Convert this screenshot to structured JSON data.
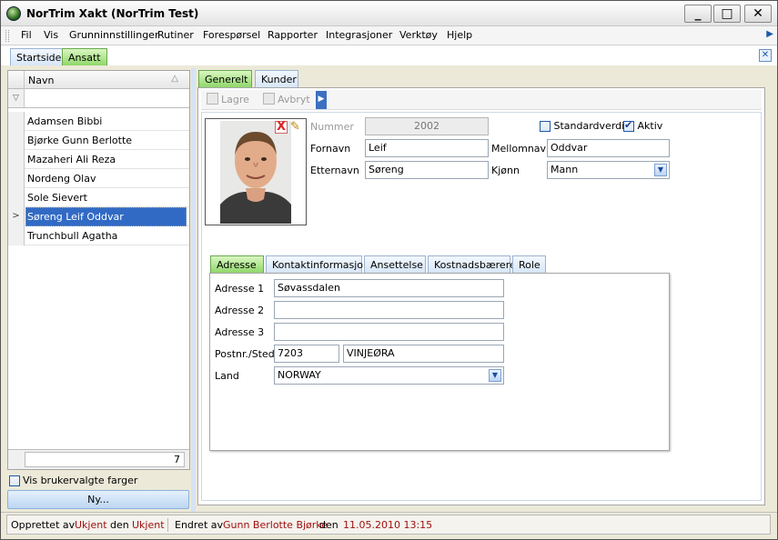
{
  "window": {
    "title": "NorTrim Xakt (NorTrim Test)",
    "minimize": "_",
    "maximize": "□",
    "close": "✕"
  },
  "menubar": {
    "items": [
      "Fil",
      "Vis",
      "Grunninnstillinger",
      "Rutiner",
      "Forespørsel",
      "Rapporter",
      "Integrasjoner",
      "Verktøy",
      "Hjelp"
    ],
    "overflow_arrow": "▶"
  },
  "doc_tabs": {
    "items": [
      {
        "label": "Startside",
        "active": false
      },
      {
        "label": "Ansatt",
        "active": true
      }
    ],
    "close": "✕"
  },
  "employee_list": {
    "column_header": "Navn",
    "sort_indicator": "△",
    "filter_icon": "▽",
    "rows": [
      "Adamsen Bibbi",
      "Bjørke Gunn Berlotte",
      "Mazaheri Ali Reza",
      "Nordeng Olav",
      "Sole Sievert",
      "Søreng Leif Oddvar",
      "Trunchbull Agatha"
    ],
    "selected_index": 5,
    "row_indicator": ">",
    "count": "7",
    "custom_colors_label": "Vis brukervalgte farger",
    "custom_colors_checked": false,
    "new_button": "Ny..."
  },
  "detail_tabs": {
    "items": [
      {
        "label": "Generelt",
        "active": true
      },
      {
        "label": "Kunder",
        "active": false
      }
    ]
  },
  "toolbar": {
    "save_label": "Lagre",
    "cancel_label": "Avbryt",
    "overflow": "▶"
  },
  "form": {
    "photo_delete": "X",
    "photo_edit": "✎",
    "nummer_label": "Nummer",
    "nummer_value": "2002",
    "standardverdi_label": "Standardverdi",
    "standardverdi_checked": false,
    "aktiv_label": "Aktiv",
    "aktiv_checked": true,
    "fornavn_label": "Fornavn",
    "fornavn_value": "Leif",
    "mellomnavn_label": "Mellomnavn",
    "mellomnavn_value": "Oddvar",
    "etternavn_label": "Etternavn",
    "etternavn_value": "Søreng",
    "kjonn_label": "Kjønn",
    "kjonn_value": "Mann",
    "dropdown_arrow": "▼"
  },
  "sub_tabs": {
    "items": [
      {
        "label": "Adresse",
        "active": true
      },
      {
        "label": "Kontaktinformasjon",
        "active": false
      },
      {
        "label": "Ansettelse",
        "active": false
      },
      {
        "label": "Kostnadsbærere",
        "active": false
      },
      {
        "label": "Role",
        "active": false
      }
    ]
  },
  "address": {
    "adresse1_label": "Adresse 1",
    "adresse1_value": "Søvassdalen",
    "adresse2_label": "Adresse 2",
    "adresse2_value": "",
    "adresse3_label": "Adresse 3",
    "adresse3_value": "",
    "postnr_label": "Postnr./Sted",
    "postnr_value": "7203",
    "sted_value": "VINJEØRA",
    "land_label": "Land",
    "land_value": "NORWAY"
  },
  "statusbar": {
    "created_by_label": "Opprettet av",
    "created_by_value": "Ukjent",
    "created_on_label": "den",
    "created_on_value": "Ukjent",
    "changed_by_label": "Endret av",
    "changed_by_value": "Gunn Berlotte Bjørke",
    "changed_on_label": "den",
    "changed_on_value": "11.05.2010 13:15"
  }
}
